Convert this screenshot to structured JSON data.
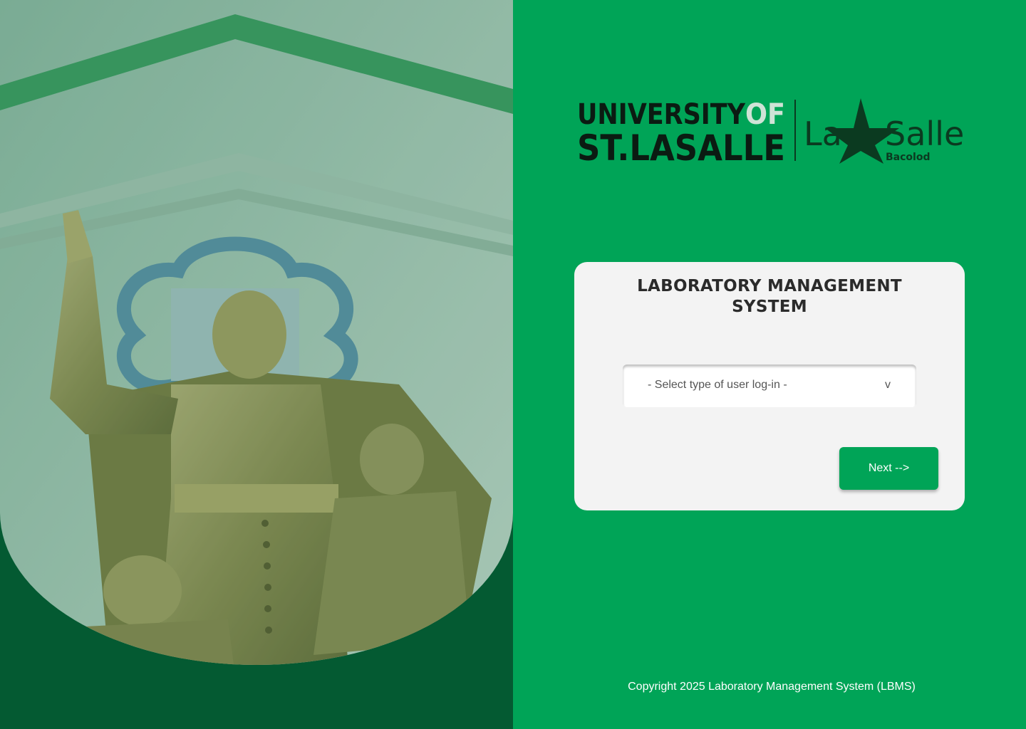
{
  "left_panel": {
    "background_color": "#045a32",
    "image_subject": "statue-of-saint-in-front-of-building"
  },
  "logo": {
    "line1_a": "UNIVERSITY",
    "line1_b": "OF",
    "line2": "ST.LASALLE",
    "brand_a": "La",
    "brand_b": "Salle",
    "brand_sub": "Bacolod"
  },
  "login": {
    "title": "LABORATORY MANAGEMENT SYSTEM",
    "select": {
      "placeholder": "- Select type of user log-in -",
      "chevron": "v"
    },
    "next_label": "Next -->"
  },
  "footer": {
    "copyright": "Copyright 2025 Laboratory Management System (LBMS)"
  },
  "colors": {
    "primary_green": "#00a457",
    "dark_green": "#045a32",
    "card_bg": "#f3f3f3"
  }
}
